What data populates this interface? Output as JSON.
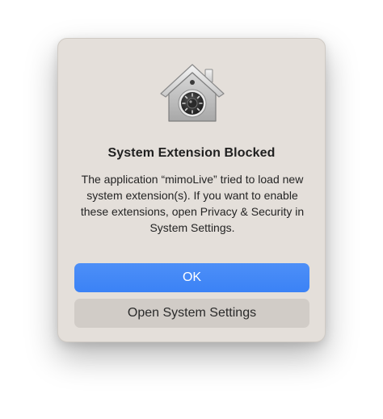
{
  "dialog": {
    "icon": "lock-house-icon",
    "title": "System Extension Blocked",
    "message": "The application “mimoLive” tried to load new system extension(s). If you want to enable these extensions, open Privacy & Security in System Settings.",
    "buttons": {
      "ok_label": "OK",
      "open_settings_label": "Open System Settings"
    }
  },
  "colors": {
    "primary_button": "#3b82f6",
    "secondary_button": "#d1ccc7",
    "dialog_background": "#e4dfda"
  }
}
